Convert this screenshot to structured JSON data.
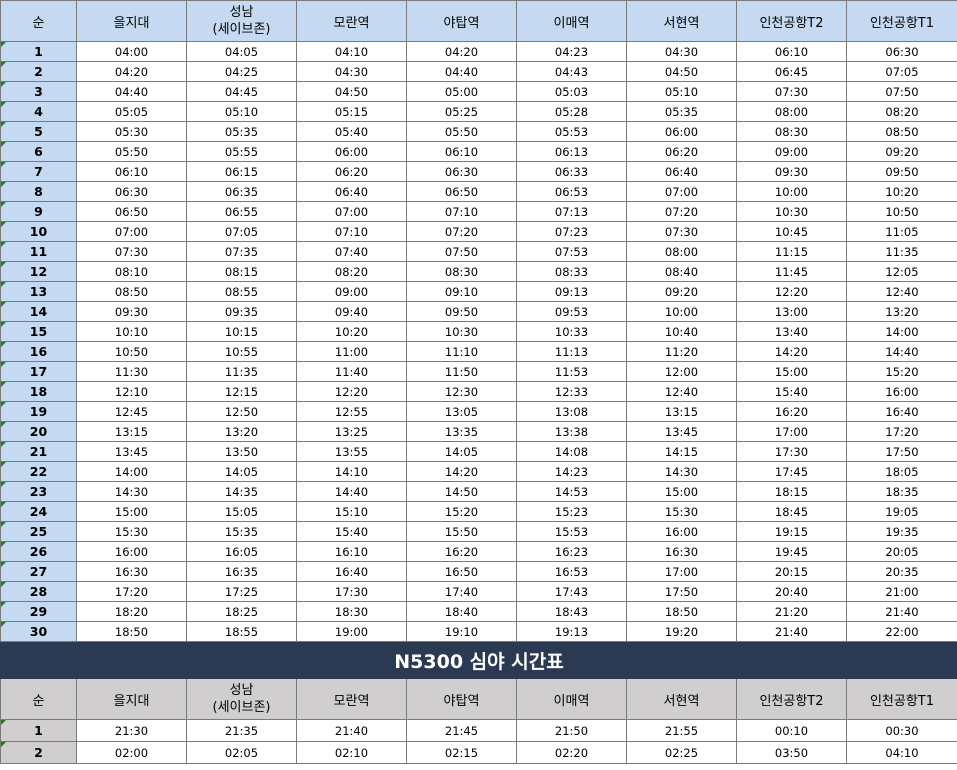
{
  "table1": {
    "headers": [
      "순",
      "을지대",
      [
        "성남",
        "(세이브존)"
      ],
      "모란역",
      "야탑역",
      "이매역",
      "서현역",
      "인천공항T2",
      "인천공항T1"
    ],
    "rows": [
      [
        "1",
        "04:00",
        "04:05",
        "04:10",
        "04:20",
        "04:23",
        "04:30",
        "06:10",
        "06:30"
      ],
      [
        "2",
        "04:20",
        "04:25",
        "04:30",
        "04:40",
        "04:43",
        "04:50",
        "06:45",
        "07:05"
      ],
      [
        "3",
        "04:40",
        "04:45",
        "04:50",
        "05:00",
        "05:03",
        "05:10",
        "07:30",
        "07:50"
      ],
      [
        "4",
        "05:05",
        "05:10",
        "05:15",
        "05:25",
        "05:28",
        "05:35",
        "08:00",
        "08:20"
      ],
      [
        "5",
        "05:30",
        "05:35",
        "05:40",
        "05:50",
        "05:53",
        "06:00",
        "08:30",
        "08:50"
      ],
      [
        "6",
        "05:50",
        "05:55",
        "06:00",
        "06:10",
        "06:13",
        "06:20",
        "09:00",
        "09:20"
      ],
      [
        "7",
        "06:10",
        "06:15",
        "06:20",
        "06:30",
        "06:33",
        "06:40",
        "09:30",
        "09:50"
      ],
      [
        "8",
        "06:30",
        "06:35",
        "06:40",
        "06:50",
        "06:53",
        "07:00",
        "10:00",
        "10:20"
      ],
      [
        "9",
        "06:50",
        "06:55",
        "07:00",
        "07:10",
        "07:13",
        "07:20",
        "10:30",
        "10:50"
      ],
      [
        "10",
        "07:00",
        "07:05",
        "07:10",
        "07:20",
        "07:23",
        "07:30",
        "10:45",
        "11:05"
      ],
      [
        "11",
        "07:30",
        "07:35",
        "07:40",
        "07:50",
        "07:53",
        "08:00",
        "11:15",
        "11:35"
      ],
      [
        "12",
        "08:10",
        "08:15",
        "08:20",
        "08:30",
        "08:33",
        "08:40",
        "11:45",
        "12:05"
      ],
      [
        "13",
        "08:50",
        "08:55",
        "09:00",
        "09:10",
        "09:13",
        "09:20",
        "12:20",
        "12:40"
      ],
      [
        "14",
        "09:30",
        "09:35",
        "09:40",
        "09:50",
        "09:53",
        "10:00",
        "13:00",
        "13:20"
      ],
      [
        "15",
        "10:10",
        "10:15",
        "10:20",
        "10:30",
        "10:33",
        "10:40",
        "13:40",
        "14:00"
      ],
      [
        "16",
        "10:50",
        "10:55",
        "11:00",
        "11:10",
        "11:13",
        "11:20",
        "14:20",
        "14:40"
      ],
      [
        "17",
        "11:30",
        "11:35",
        "11:40",
        "11:50",
        "11:53",
        "12:00",
        "15:00",
        "15:20"
      ],
      [
        "18",
        "12:10",
        "12:15",
        "12:20",
        "12:30",
        "12:33",
        "12:40",
        "15:40",
        "16:00"
      ],
      [
        "19",
        "12:45",
        "12:50",
        "12:55",
        "13:05",
        "13:08",
        "13:15",
        "16:20",
        "16:40"
      ],
      [
        "20",
        "13:15",
        "13:20",
        "13:25",
        "13:35",
        "13:38",
        "13:45",
        "17:00",
        "17:20"
      ],
      [
        "21",
        "13:45",
        "13:50",
        "13:55",
        "14:05",
        "14:08",
        "14:15",
        "17:30",
        "17:50"
      ],
      [
        "22",
        "14:00",
        "14:05",
        "14:10",
        "14:20",
        "14:23",
        "14:30",
        "17:45",
        "18:05"
      ],
      [
        "23",
        "14:30",
        "14:35",
        "14:40",
        "14:50",
        "14:53",
        "15:00",
        "18:15",
        "18:35"
      ],
      [
        "24",
        "15:00",
        "15:05",
        "15:10",
        "15:20",
        "15:23",
        "15:30",
        "18:45",
        "19:05"
      ],
      [
        "25",
        "15:30",
        "15:35",
        "15:40",
        "15:50",
        "15:53",
        "16:00",
        "19:15",
        "19:35"
      ],
      [
        "26",
        "16:00",
        "16:05",
        "16:10",
        "16:20",
        "16:23",
        "16:30",
        "19:45",
        "20:05"
      ],
      [
        "27",
        "16:30",
        "16:35",
        "16:40",
        "16:50",
        "16:53",
        "17:00",
        "20:15",
        "20:35"
      ],
      [
        "28",
        "17:20",
        "17:25",
        "17:30",
        "17:40",
        "17:43",
        "17:50",
        "20:40",
        "21:00"
      ],
      [
        "29",
        "18:20",
        "18:25",
        "18:30",
        "18:40",
        "18:43",
        "18:50",
        "21:20",
        "21:40"
      ],
      [
        "30",
        "18:50",
        "18:55",
        "19:00",
        "19:10",
        "19:13",
        "19:20",
        "21:40",
        "22:00"
      ]
    ]
  },
  "night_title": "N5300 심야 시간표",
  "table2": {
    "headers": [
      "순",
      "을지대",
      [
        "성남",
        "(세이브존)"
      ],
      "모란역",
      "야탑역",
      "이매역",
      "서현역",
      "인천공항T2",
      "인천공항T1"
    ],
    "rows": [
      [
        "1",
        "21:30",
        "21:35",
        "21:40",
        "21:45",
        "21:50",
        "21:55",
        "00:10",
        "00:30"
      ],
      [
        "2",
        "02:00",
        "02:05",
        "02:10",
        "02:15",
        "02:20",
        "02:25",
        "03:50",
        "04:10"
      ]
    ]
  },
  "colors": {
    "header_blue": "#c5d9f1",
    "header_gray": "#d0cece",
    "title_bar": "#2b3a52"
  }
}
